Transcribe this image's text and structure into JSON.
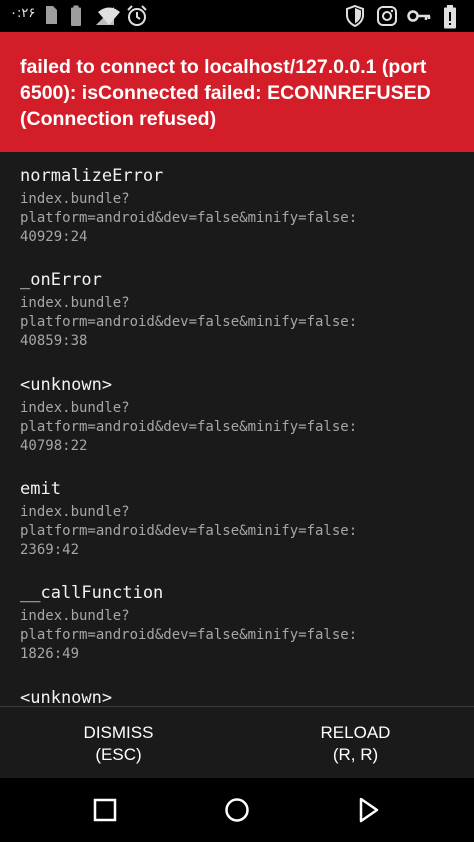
{
  "status_bar": {
    "time": "۰:۲۶",
    "icons": [
      "sim-card-icon",
      "battery-outline-icon",
      "signal-icon",
      "wifi-icon",
      "alarm-icon",
      "shield-icon",
      "instagram-icon",
      "key-icon",
      "battery-alert-icon"
    ]
  },
  "error": {
    "message": "failed to connect to localhost/127.0.0.1 (port 6500): isConnected failed: ECONNREFUSED (Connection refused)",
    "color": "#d31e2a"
  },
  "stack": [
    {
      "fn": "normalizeError",
      "loc": "index.bundle?\nplatform=android&dev=false&minify=false:\n40929:24"
    },
    {
      "fn": "_onError",
      "loc": "index.bundle?\nplatform=android&dev=false&minify=false:\n40859:38"
    },
    {
      "fn": "<unknown>",
      "loc": "index.bundle?\nplatform=android&dev=false&minify=false:\n40798:22"
    },
    {
      "fn": "emit",
      "loc": "index.bundle?\nplatform=android&dev=false&minify=false:\n2369:42"
    },
    {
      "fn": "__callFunction",
      "loc": "index.bundle?\nplatform=android&dev=false&minify=false:\n1826:49"
    },
    {
      "fn": "<unknown>",
      "loc": ""
    }
  ],
  "buttons": {
    "dismiss": {
      "label": "DISMISS",
      "shortcut": "(ESC)"
    },
    "reload": {
      "label": "RELOAD",
      "shortcut": "(R, R)"
    }
  },
  "nav": {
    "icons": [
      "recents-square-icon",
      "home-circle-icon",
      "back-triangle-icon"
    ]
  }
}
